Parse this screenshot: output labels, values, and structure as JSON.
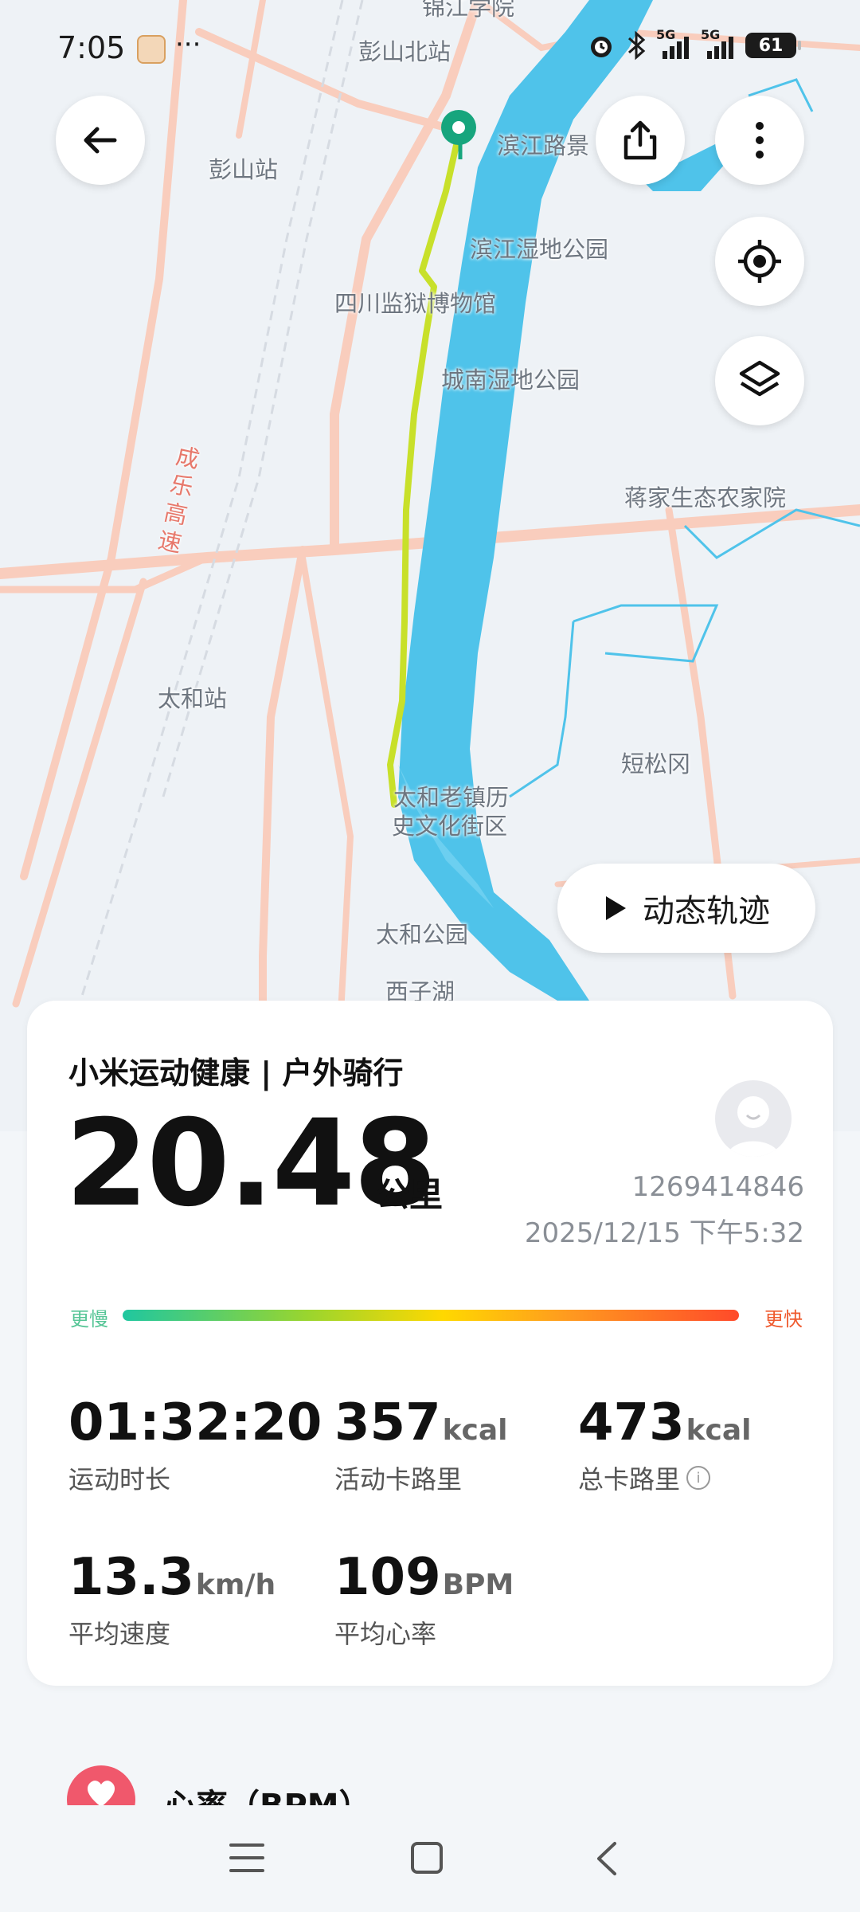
{
  "status_bar": {
    "time": "7:05",
    "more": "···",
    "signal1": "5G",
    "signal2": "5G",
    "battery": "61"
  },
  "map": {
    "labels": {
      "jinjiang": "锦江学院",
      "pengshan_north": "彭山北站",
      "pengshan": "彭山站",
      "binjiang_road": "滨江路景",
      "binjiang_wetland": "滨江湿地公园",
      "sichuan_prison": "四川监狱博物馆",
      "chengnan_wetland": "城南湿地公园",
      "jiangjia": "蒋家生态农家院",
      "chengle": "成乐高速",
      "taihe_station": "太和站",
      "duansonggang": "短松冈",
      "taihe_oldtown_1": "太和老镇历",
      "taihe_oldtown_2": "史文化街区",
      "taihe_park": "太和公园",
      "xizihu": "西子湖"
    },
    "replay_button": "动态轨迹"
  },
  "card": {
    "title": "小米运动健康 | 户外骑行",
    "distance": "20.48",
    "distance_unit": "公里",
    "user_id": "1269414846",
    "datetime": "2025/12/15 下午5:32",
    "legend_slow": "更慢",
    "legend_fast": "更快",
    "stats": {
      "duration": {
        "value": "01:32:20",
        "unit": "",
        "label": "运动时长"
      },
      "active_cal": {
        "value": "357",
        "unit": "kcal",
        "label": "活动卡路里"
      },
      "total_cal": {
        "value": "473",
        "unit": "kcal",
        "label": "总卡路里"
      },
      "avg_speed": {
        "value": "13.3",
        "unit": "km/h",
        "label": "平均速度"
      },
      "avg_hr": {
        "value": "109",
        "unit": "BPM",
        "label": "平均心率"
      }
    }
  },
  "heart_section": {
    "title": "心率（BPM）"
  },
  "colors": {
    "river": "#4fc3ea",
    "route_start": "#c8e02a",
    "start_marker": "#17a57d",
    "road": "#f8c8b8",
    "accent_slow": "#56c596",
    "accent_fast": "#ef5a2e"
  }
}
